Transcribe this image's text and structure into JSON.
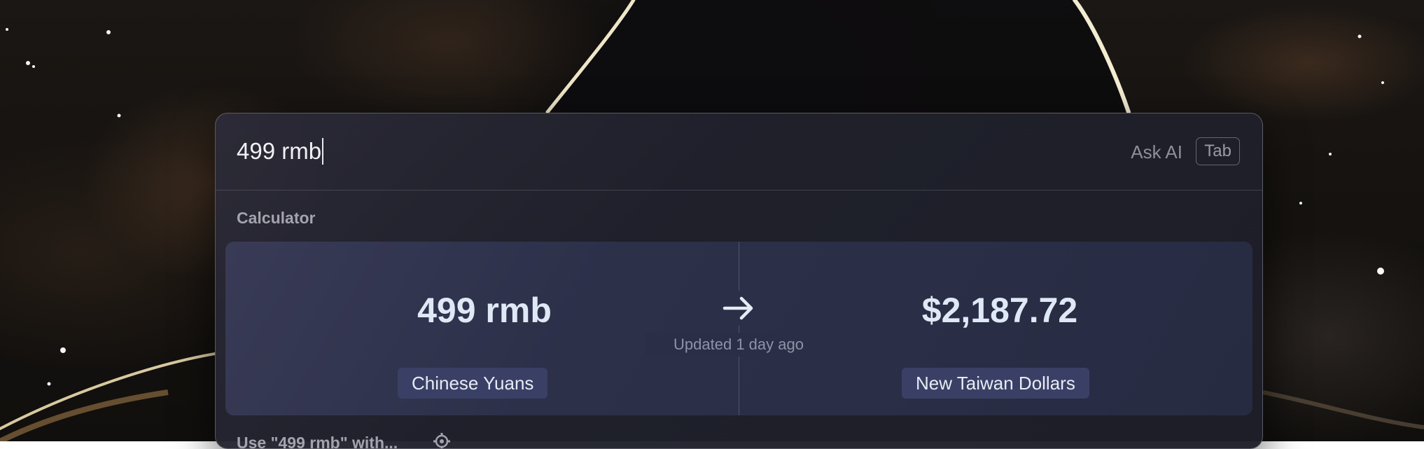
{
  "search": {
    "query": "499 rmb",
    "ask_ai_label": "Ask AI",
    "tab_key_label": "Tab"
  },
  "calculator": {
    "section_title": "Calculator",
    "input_value": "499 rmb",
    "input_unit": "Chinese Yuans",
    "result_value": "$2,187.72",
    "result_unit": "New Taiwan Dollars",
    "updated_text": "Updated 1 day ago",
    "arrow_icon": "arrow-right-icon"
  },
  "footer": {
    "use_with_label": "Use \"499 rmb\" with...",
    "settings_icon": "gear-icon"
  },
  "colors": {
    "panel_bg": "#20212c",
    "card_bg": "#2c3049",
    "chip_bg": "#3a4065",
    "value_text": "#dfe9f6",
    "muted_text": "#8e8e98"
  }
}
